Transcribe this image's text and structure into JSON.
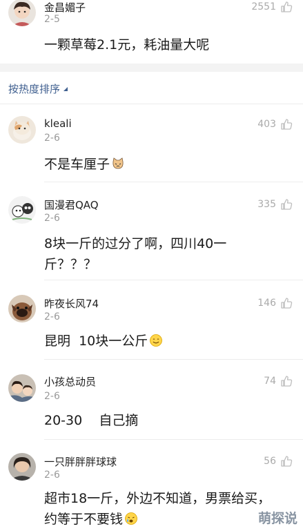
{
  "top_comment": {
    "name": "金昌媚子",
    "date": "2-5",
    "likes": "2551",
    "text": "一颗草莓2.1元，耗油量大呢"
  },
  "sort": {
    "label": "按热度排序"
  },
  "comments": [
    {
      "name": "kleali",
      "date": "2-6",
      "likes": "403",
      "text": "不是车厘子"
    },
    {
      "name": "国漫君QAQ",
      "date": "2-6",
      "likes": "335",
      "text_line1": "8块一斤的过分了啊，四川40一",
      "text_line2": "斤？？？"
    },
    {
      "name": "昨夜长风74",
      "date": "2-6",
      "likes": "146",
      "text": "昆明  10块一公斤"
    },
    {
      "name": "小孩总动员",
      "date": "2-6",
      "likes": "74",
      "text": "20-30    自己摘"
    },
    {
      "name": "一只胖胖胖球球",
      "date": "2-6",
      "likes": "56",
      "text_line1": "超市18一斤，外边不知道，男票给买，",
      "text_line2": "约等于不要钱"
    }
  ],
  "watermark": "萌探说",
  "colors": {
    "link": "#3f5f8f",
    "gray_text": "#9a9a9a",
    "band": "#f3f3f3"
  }
}
